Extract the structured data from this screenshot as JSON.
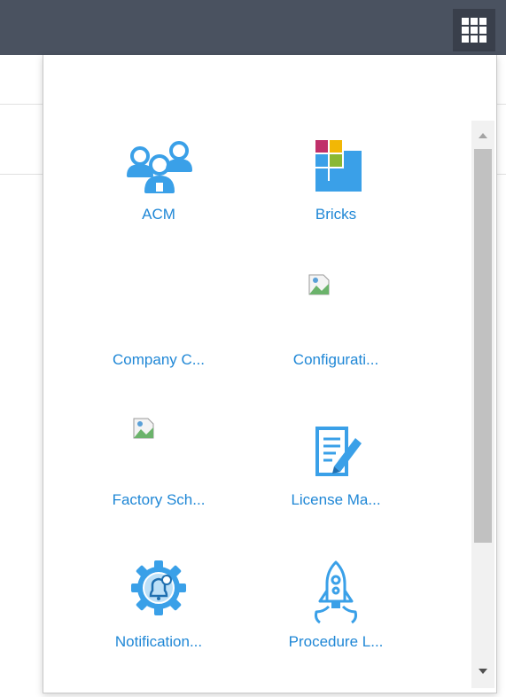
{
  "apps": [
    {
      "label": "ACM",
      "icon": "users-group-icon"
    },
    {
      "label": "Bricks",
      "icon": "bricks-icon"
    },
    {
      "label": "Company C...",
      "icon": "missing-image-icon"
    },
    {
      "label": "Configurati...",
      "icon": "broken-image-icon"
    },
    {
      "label": "Factory Sch...",
      "icon": "broken-image-icon"
    },
    {
      "label": "License Ma...",
      "icon": "license-document-icon"
    },
    {
      "label": "Notification...",
      "icon": "notification-gear-icon"
    },
    {
      "label": "Procedure L...",
      "icon": "rocket-icon"
    }
  ],
  "colors": {
    "topbar": "#4a5260",
    "accent": "#1f87d6",
    "icon_blue": "#3aa0e8"
  }
}
